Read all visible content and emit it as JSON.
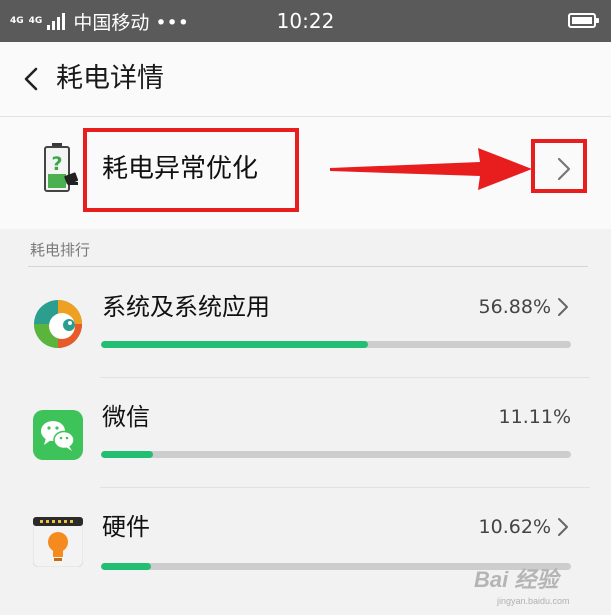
{
  "status_bar": {
    "network_1": "4G",
    "network_2": "4G",
    "carrier": "中国移动 •••",
    "time": "10:22"
  },
  "header": {
    "back_icon": "chevron-left-icon",
    "title": "耗电详情"
  },
  "anomaly": {
    "icon": "battery-warning-icon",
    "label": "耗电异常优化",
    "chevron_icon": "chevron-right-icon"
  },
  "annotation_colors": {
    "highlight": "#e81e1e"
  },
  "ranking": {
    "section_title": "耗电排行",
    "bar_color": "#21be74",
    "items": [
      {
        "name": "系统及系统应用",
        "percent": "56.88%",
        "fraction": 0.5688,
        "icon": "system-apps-icon",
        "has_chevron": true
      },
      {
        "name": "微信",
        "percent": "11.11%",
        "fraction": 0.1111,
        "icon": "wechat-icon",
        "has_chevron": false
      },
      {
        "name": "硬件",
        "percent": "10.62%",
        "fraction": 0.1062,
        "icon": "hardware-bulb-icon",
        "has_chevron": true
      }
    ]
  },
  "watermark": {
    "text": "Bai 经验",
    "sub": "jingyan.baidu.com"
  }
}
